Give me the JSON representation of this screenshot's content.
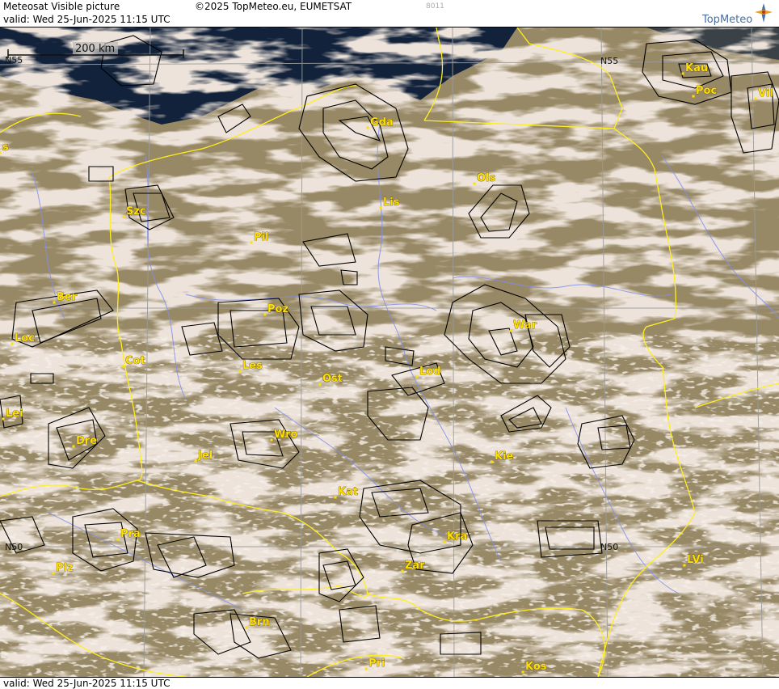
{
  "header": {
    "title": "Meteosat Visible picture",
    "copyright": "©2025 TopMeteo.eu, EUMETSAT",
    "code": "8011",
    "valid": "valid:  Wed  25-Jun-2025  11:15 UTC",
    "logo_text": "TopMeteo"
  },
  "footer": {
    "valid": "valid:  Wed  25-Jun-2025  11:15 UTC"
  },
  "map": {
    "scale_label": "200 km",
    "grid_labels": {
      "n55_left": "N55",
      "n55_mid": "N55",
      "n50_left": "N50",
      "n50_mid": "N50"
    },
    "cities": [
      {
        "name": "Gda"
      },
      {
        "name": "Kau"
      },
      {
        "name": "Poc"
      },
      {
        "name": "Vil"
      },
      {
        "name": "Ols"
      },
      {
        "name": "Lis"
      },
      {
        "name": "Szc"
      },
      {
        "name": "Pil"
      },
      {
        "name": "Ber"
      },
      {
        "name": "Poz"
      },
      {
        "name": "War"
      },
      {
        "name": "Loc"
      },
      {
        "name": "Cot"
      },
      {
        "name": "Les"
      },
      {
        "name": "Ost"
      },
      {
        "name": "Lod"
      },
      {
        "name": "Lei"
      },
      {
        "name": "Dre"
      },
      {
        "name": "Wro"
      },
      {
        "name": "Jel"
      },
      {
        "name": "Kie"
      },
      {
        "name": "Kat"
      },
      {
        "name": "Pra"
      },
      {
        "name": "Kra"
      },
      {
        "name": "Plz"
      },
      {
        "name": "Zar"
      },
      {
        "name": "LVi"
      },
      {
        "name": "Brn"
      },
      {
        "name": "Pri"
      },
      {
        "name": "Kos"
      },
      {
        "name": "s"
      }
    ],
    "colors": {
      "cloud": "#d9c3b2",
      "land": "#6f6a3c",
      "sea": "#12223a",
      "border": "#ffee22",
      "river": "#7f8ef0",
      "grid": "#9a9a9a",
      "airspace": "#000000"
    }
  }
}
